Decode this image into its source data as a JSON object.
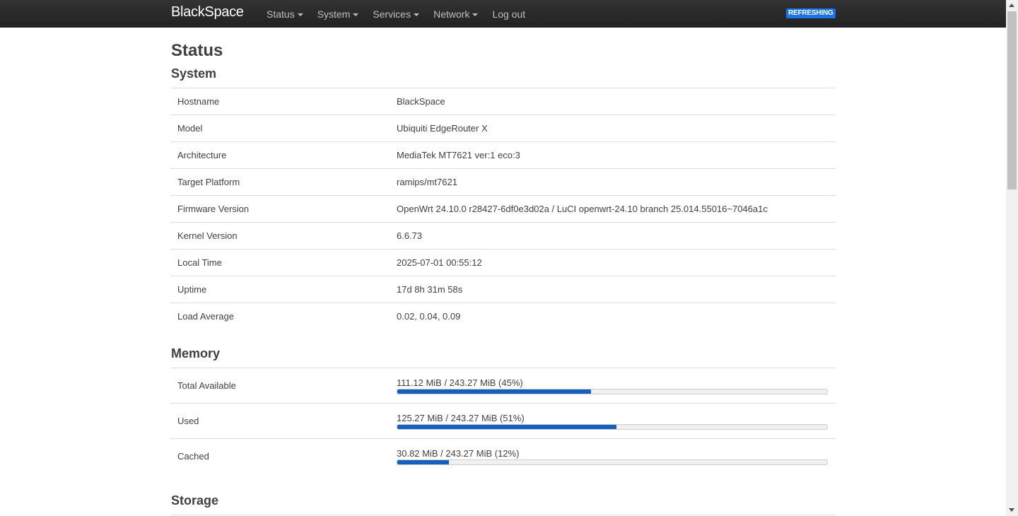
{
  "brand": "BlackSpace",
  "nav": [
    {
      "label": "Status",
      "dropdown": true
    },
    {
      "label": "System",
      "dropdown": true
    },
    {
      "label": "Services",
      "dropdown": true
    },
    {
      "label": "Network",
      "dropdown": true
    },
    {
      "label": "Log out",
      "dropdown": false
    }
  ],
  "refresh_badge": "REFRESHING",
  "page_title": "Status",
  "system": {
    "title": "System",
    "rows": [
      {
        "label": "Hostname",
        "value": "BlackSpace"
      },
      {
        "label": "Model",
        "value": "Ubiquiti EdgeRouter X"
      },
      {
        "label": "Architecture",
        "value": "MediaTek MT7621 ver:1 eco:3"
      },
      {
        "label": "Target Platform",
        "value": "ramips/mt7621"
      },
      {
        "label": "Firmware Version",
        "value": "OpenWrt 24.10.0 r28427-6df0e3d02a / LuCI openwrt-24.10 branch 25.014.55016~7046a1c"
      },
      {
        "label": "Kernel Version",
        "value": "6.6.73"
      },
      {
        "label": "Local Time",
        "value": "2025-07-01 00:55:12"
      },
      {
        "label": "Uptime",
        "value": "17d 8h 31m 58s"
      },
      {
        "label": "Load Average",
        "value": "0.02, 0.04, 0.09"
      }
    ]
  },
  "memory": {
    "title": "Memory",
    "rows": [
      {
        "label": "Total Available",
        "text": "111.12 MiB / 243.27 MiB (45%)",
        "percent": 45
      },
      {
        "label": "Used",
        "text": "125.27 MiB / 243.27 MiB (51%)",
        "percent": 51
      },
      {
        "label": "Cached",
        "text": "30.82 MiB / 243.27 MiB (12%)",
        "percent": 12
      }
    ]
  },
  "storage": {
    "title": "Storage"
  },
  "colors": {
    "navbar": "#222222",
    "accent": "#1560bd",
    "badge": "#1a73e8"
  }
}
